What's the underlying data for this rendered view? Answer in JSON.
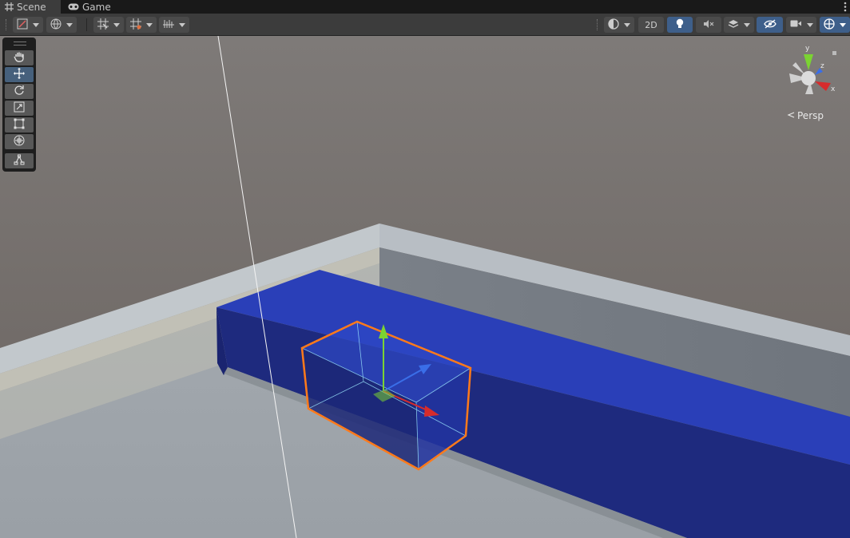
{
  "tabs": [
    {
      "label": "Scene",
      "icon": "grid-icon",
      "active": true
    },
    {
      "label": "Game",
      "icon": "gamepad-icon",
      "active": false
    }
  ],
  "toolbar": {
    "left_buttons": [
      "draw-mode",
      "global-local",
      "grid-snapping",
      "increment-snap",
      "scene-visibility-grid"
    ],
    "toggle_2d_label": "2D",
    "right_buttons": [
      "shading-mode",
      "2D",
      "lighting",
      "audio",
      "effects",
      "hidden-objects",
      "scene-camera",
      "gizmos"
    ]
  },
  "tools": [
    "hand-tool",
    "move-tool",
    "rotate-tool",
    "scale-tool",
    "rect-tool",
    "transform-tool",
    "custom-editor-tool"
  ],
  "active_tool": "move-tool",
  "gizmo": {
    "y_label": "y",
    "z_label": "z",
    "x_label": "x",
    "projection_label": "Persp"
  },
  "colors": {
    "sky": "#6e6662",
    "floor": "#a8aeb4",
    "blue_box": "#2a3fb8",
    "selection": "#ff7a1a",
    "gizmo_x": "#d62c2c",
    "gizmo_y": "#7bd332",
    "gizmo_z": "#3a6ee8"
  }
}
